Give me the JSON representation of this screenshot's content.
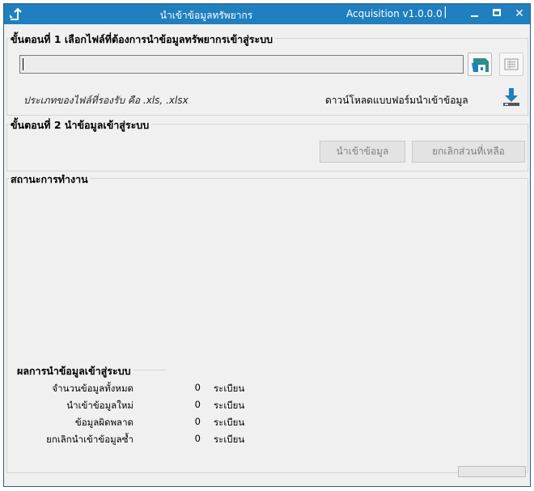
{
  "window": {
    "title": "นำเข้าข้อมูลทรัพยากร",
    "version": "Acquisition v1.0.0.0",
    "separator": "|"
  },
  "step1": {
    "title": "ขั้นตอนที่ 1 เลือกไฟล์ที่ต้องการนำข้อมูลทรัพยากรเข้าสู่ระบบ",
    "file_path_value": "",
    "supported_note": "ประเภทของไฟล์ที่รองรับ คือ .xls, .xlsx",
    "download_label": "ดาวน์โหลดแบบฟอร์มนำเข้าข้อมูล"
  },
  "step2": {
    "title": "ขั้นตอนที่ 2 นำข้อมูลเข้าสู่ระบบ",
    "import_button": "นำเข้าข้อมูล",
    "cancel_button": "ยกเลิกส่วนที่เหลือ"
  },
  "status": {
    "title": "สถานะการทำงาน"
  },
  "results": {
    "title": "ผลการนำข้อมูลเข้าสู่ระบบ",
    "rows": [
      {
        "label": "จำนวนข้อมูลทั้งหมด",
        "value": "0",
        "unit": "ระเบียน"
      },
      {
        "label": "นำเข้าข้อมูลใหม่",
        "value": "0",
        "unit": "ระเบียน"
      },
      {
        "label": "ข้อมูลผิดพลาด",
        "value": "0",
        "unit": "ระเบียน"
      },
      {
        "label": "ยกเลิกนำเข้าข้อมูลซ้ำ",
        "value": "0",
        "unit": "ระเบียน"
      }
    ]
  },
  "progress": 0,
  "icons": {
    "app": "import-arrow-icon",
    "browse": "folder-open-icon",
    "list": "list-view-icon",
    "download": "download-icon"
  },
  "colors": {
    "titlebar": "#1f7fbf",
    "window_bg": "#f0f0f0",
    "disabled_text": "#7f7f7f"
  }
}
